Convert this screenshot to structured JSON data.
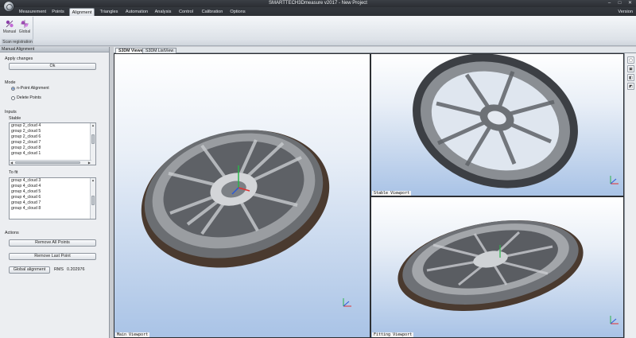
{
  "window": {
    "title": "SMARTTECH3Dmeasure v2017 - New Project"
  },
  "menu": {
    "tabs": [
      {
        "label": "Measurement"
      },
      {
        "label": "Points"
      },
      {
        "label": "Alignment"
      },
      {
        "label": "Triangles"
      },
      {
        "label": "Automation"
      },
      {
        "label": "Analysis"
      },
      {
        "label": "Control"
      },
      {
        "label": "Calibration"
      },
      {
        "label": "Options"
      }
    ],
    "active": "Alignment",
    "version_label": "Version"
  },
  "ribbon": {
    "buttons": [
      {
        "label": "Manual"
      },
      {
        "label": "Global"
      }
    ],
    "group_label": "Scan registration"
  },
  "panel": {
    "header": "Manual Alignment",
    "apply_label": "Apply changes",
    "ok_label": "Ok",
    "mode_label": "Mode",
    "mode_options": [
      {
        "label": "n-Point Alignment",
        "checked": true
      },
      {
        "label": "Delete Points",
        "checked": false
      }
    ],
    "inputs_label": "Inputs",
    "stable_label": "Stable",
    "stable_items": [
      "group 2_cloud 4",
      "group 2_cloud 5",
      "group 2_cloud 6",
      "group 2_cloud 7",
      "group 2_cloud 8",
      "group 4_cloud 1"
    ],
    "tofit_label": "To fit",
    "tofit_items": [
      "group 4_cloud 3",
      "group 4_cloud 4",
      "group 4_cloud 5",
      "group 4_cloud 6",
      "group 4_cloud 7",
      "group 4_cloud 8"
    ],
    "actions_label": "Actions",
    "remove_all_label": "Remove All Points",
    "remove_last_label": "Remove Last Point",
    "global_alignment_label": "Global alignment",
    "rms_label": "RMS",
    "rms_value": "0.202976"
  },
  "viewer": {
    "tabs": [
      {
        "label": "S3DM Viewer",
        "active": true
      },
      {
        "label": "S3DM ListView",
        "active": false
      }
    ],
    "viewports": {
      "main": "Main Viewport",
      "stable": "Stable Viewport",
      "fitting": "Fitting Viewport"
    }
  },
  "colors": {
    "accent": "#2a5fb0",
    "viewport_top": "#ffffff",
    "viewport_bottom": "#a9c3e6",
    "chrome_dark": "#2c2f34"
  }
}
